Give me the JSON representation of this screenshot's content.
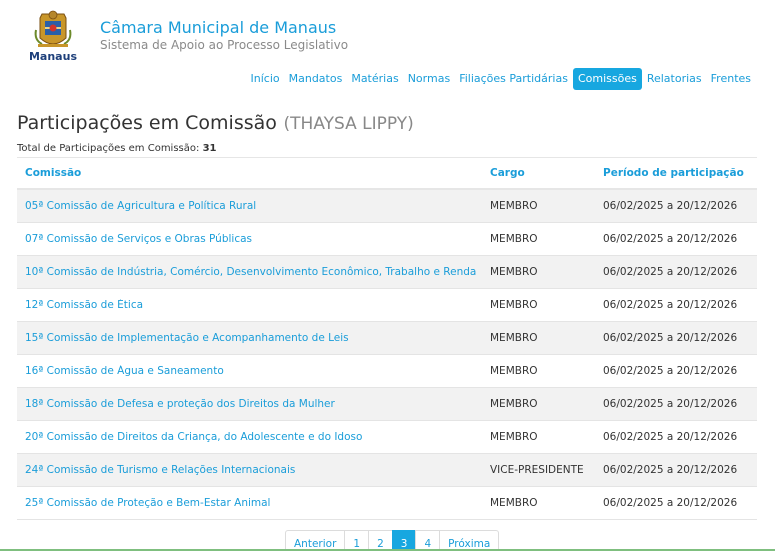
{
  "header": {
    "title": "Câmara Municipal de Manaus",
    "subtitle": "Sistema de Apoio ao Processo Legislativo",
    "logo_text": "Manaus"
  },
  "nav": {
    "items": [
      {
        "label": "Início"
      },
      {
        "label": "Mandatos"
      },
      {
        "label": "Matérias"
      },
      {
        "label": "Normas"
      },
      {
        "label": "Filiações Partidárias"
      },
      {
        "label": "Comissões"
      },
      {
        "label": "Relatorias"
      },
      {
        "label": "Frentes"
      }
    ],
    "active": "Comissões"
  },
  "page": {
    "title": "Participações em Comissão",
    "person": "(THAYSA LIPPY)",
    "total_label": "Total de Participações em Comissão:",
    "total_value": "31"
  },
  "table": {
    "headers": [
      "Comissão",
      "Cargo",
      "Período de participação"
    ],
    "rows": [
      {
        "comissao": "05ª Comissão de Agricultura e Política Rural",
        "cargo": "MEMBRO",
        "periodo": "06/02/2025 a 20/12/2026"
      },
      {
        "comissao": "07ª Comissão de Serviços e Obras Públicas",
        "cargo": "MEMBRO",
        "periodo": "06/02/2025 a 20/12/2026"
      },
      {
        "comissao": "10ª Comissão de Indústria, Comércio, Desenvolvimento Econômico, Trabalho e Renda",
        "cargo": "MEMBRO",
        "periodo": "06/02/2025 a 20/12/2026"
      },
      {
        "comissao": "12ª Comissão de Ética",
        "cargo": "MEMBRO",
        "periodo": "06/02/2025 a 20/12/2026"
      },
      {
        "comissao": "15ª Comissão de Implementação e Acompanhamento de Leis",
        "cargo": "MEMBRO",
        "periodo": "06/02/2025 a 20/12/2026"
      },
      {
        "comissao": "16ª Comissão de Água e Saneamento",
        "cargo": "MEMBRO",
        "periodo": "06/02/2025 a 20/12/2026"
      },
      {
        "comissao": "18ª Comissão de Defesa e proteção dos Direitos da Mulher",
        "cargo": "MEMBRO",
        "periodo": "06/02/2025 a 20/12/2026"
      },
      {
        "comissao": "20ª Comissão de Direitos da Criança, do Adolescente e do Idoso",
        "cargo": "MEMBRO",
        "periodo": "06/02/2025 a 20/12/2026"
      },
      {
        "comissao": "24ª Comissão de Turismo e Relações Internacionais",
        "cargo": "VICE-PRESIDENTE",
        "periodo": "06/02/2025 a 20/12/2026"
      },
      {
        "comissao": "25ª Comissão de Proteção e Bem-Estar Animal",
        "cargo": "MEMBRO",
        "periodo": "06/02/2025 a 20/12/2026"
      }
    ]
  },
  "pagination": {
    "items": [
      "Anterior",
      "1",
      "2",
      "3",
      "4",
      "Próxima"
    ],
    "active": "3"
  },
  "colors": {
    "accent": "#1a9dd9",
    "active_bg": "#17a7e0"
  }
}
